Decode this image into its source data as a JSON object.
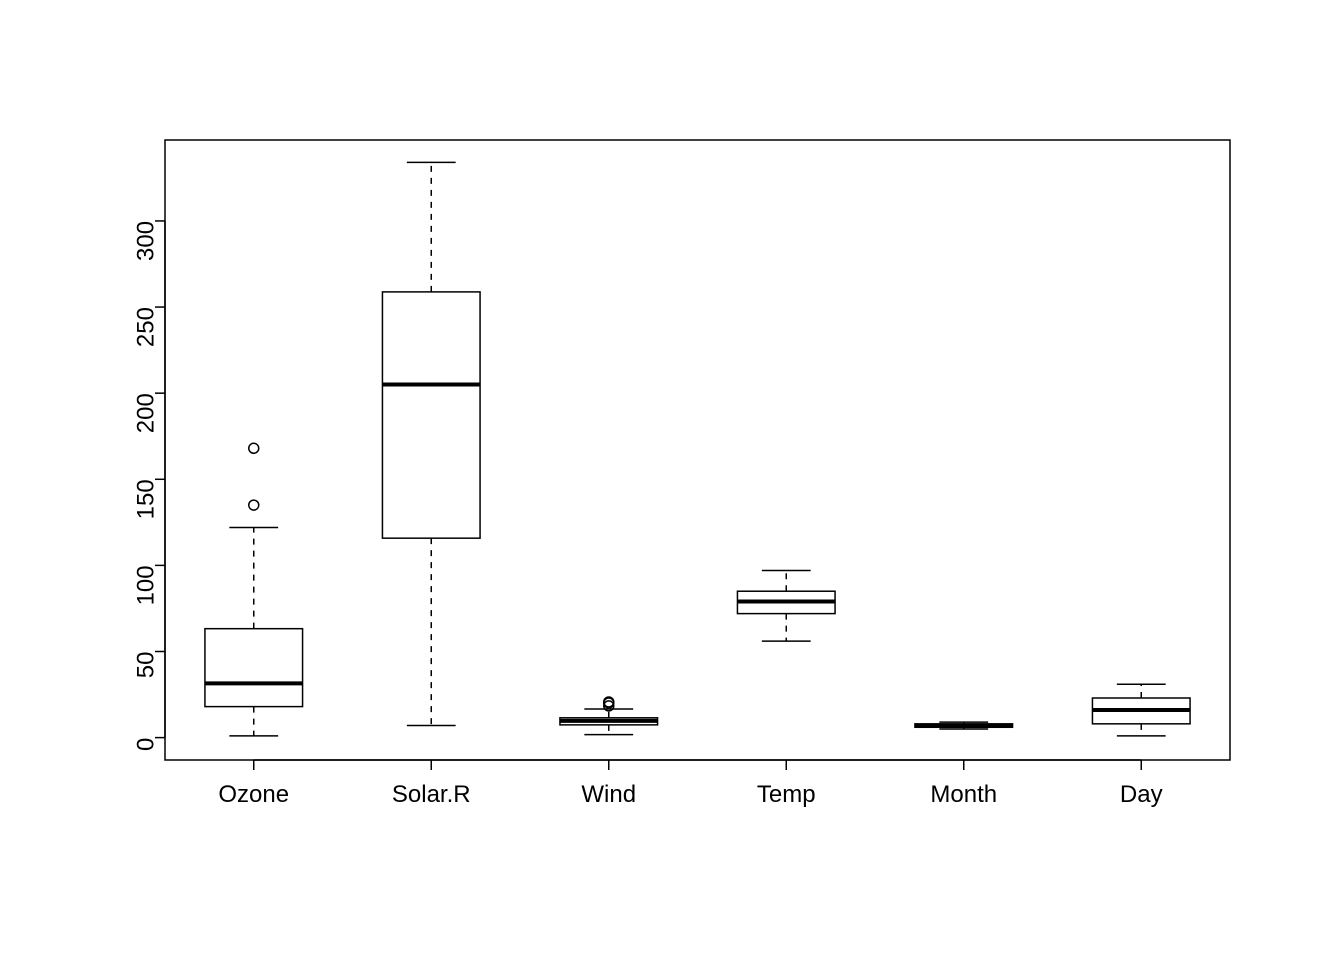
{
  "chart_data": {
    "type": "boxplot",
    "ylim": [
      0,
      334
    ],
    "y_ticks": [
      0,
      50,
      100,
      150,
      200,
      250,
      300
    ],
    "categories": [
      "Ozone",
      "Solar.R",
      "Wind",
      "Temp",
      "Month",
      "Day"
    ],
    "series": [
      {
        "name": "Ozone",
        "min": 1,
        "q1": 18,
        "median": 31.5,
        "q3": 63.25,
        "max": 122,
        "outliers": [
          135,
          168
        ]
      },
      {
        "name": "Solar.R",
        "min": 7,
        "q1": 115.8,
        "median": 205,
        "q3": 258.8,
        "max": 334,
        "outliers": []
      },
      {
        "name": "Wind",
        "min": 1.7,
        "q1": 7.4,
        "median": 9.7,
        "q3": 11.5,
        "max": 16.6,
        "outliers": [
          18.4,
          20.1,
          20.7
        ]
      },
      {
        "name": "Temp",
        "min": 56,
        "q1": 72,
        "median": 79,
        "q3": 85,
        "max": 97,
        "outliers": []
      },
      {
        "name": "Month",
        "min": 5,
        "q1": 6,
        "median": 7,
        "q3": 8,
        "max": 9,
        "outliers": []
      },
      {
        "name": "Day",
        "min": 1,
        "q1": 8,
        "median": 16,
        "q3": 23,
        "max": 31,
        "outliers": []
      }
    ]
  }
}
